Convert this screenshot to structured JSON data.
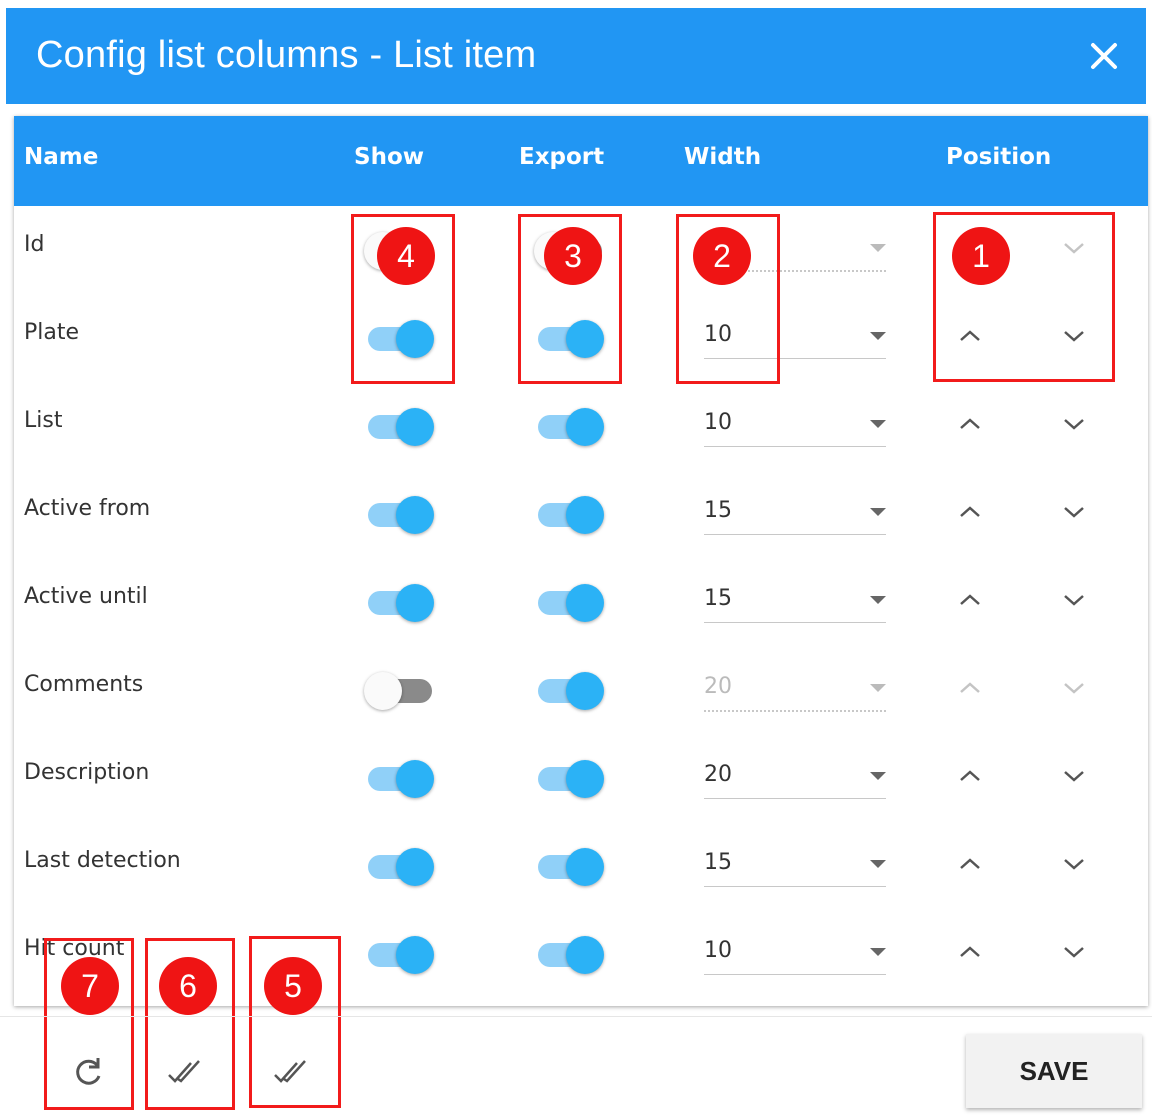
{
  "dialog": {
    "title": "Config list columns - List item",
    "close_icon": "close-icon",
    "save_label": "SAVE"
  },
  "colors": {
    "accent": "#2196f3",
    "toggle_on_thumb": "#2bb2f6",
    "toggle_on_track": "#90d0f8",
    "annotation": "#ef1414"
  },
  "headers": {
    "name": "Name",
    "show": "Show",
    "export": "Export",
    "width": "Width",
    "position": "Position"
  },
  "rows": [
    {
      "name": "Id",
      "show": false,
      "export": false,
      "width": "",
      "width_disabled": true
    },
    {
      "name": "Plate",
      "show": true,
      "export": true,
      "width": "10",
      "width_disabled": false
    },
    {
      "name": "List",
      "show": true,
      "export": true,
      "width": "10",
      "width_disabled": false
    },
    {
      "name": "Active from",
      "show": true,
      "export": true,
      "width": "15",
      "width_disabled": false
    },
    {
      "name": "Active until",
      "show": true,
      "export": true,
      "width": "15",
      "width_disabled": false
    },
    {
      "name": "Comments",
      "show": false,
      "export": true,
      "width": "20",
      "width_disabled": true
    },
    {
      "name": "Description",
      "show": true,
      "export": true,
      "width": "20",
      "width_disabled": false
    },
    {
      "name": "Last detection",
      "show": true,
      "export": true,
      "width": "15",
      "width_disabled": false
    },
    {
      "name": "Hit count",
      "show": true,
      "export": true,
      "width": "10",
      "width_disabled": false
    }
  ],
  "annotations": [
    "1",
    "2",
    "3",
    "4",
    "5",
    "6",
    "7"
  ],
  "footer_icons": [
    "refresh-icon",
    "double-check-icon",
    "double-check-icon"
  ]
}
